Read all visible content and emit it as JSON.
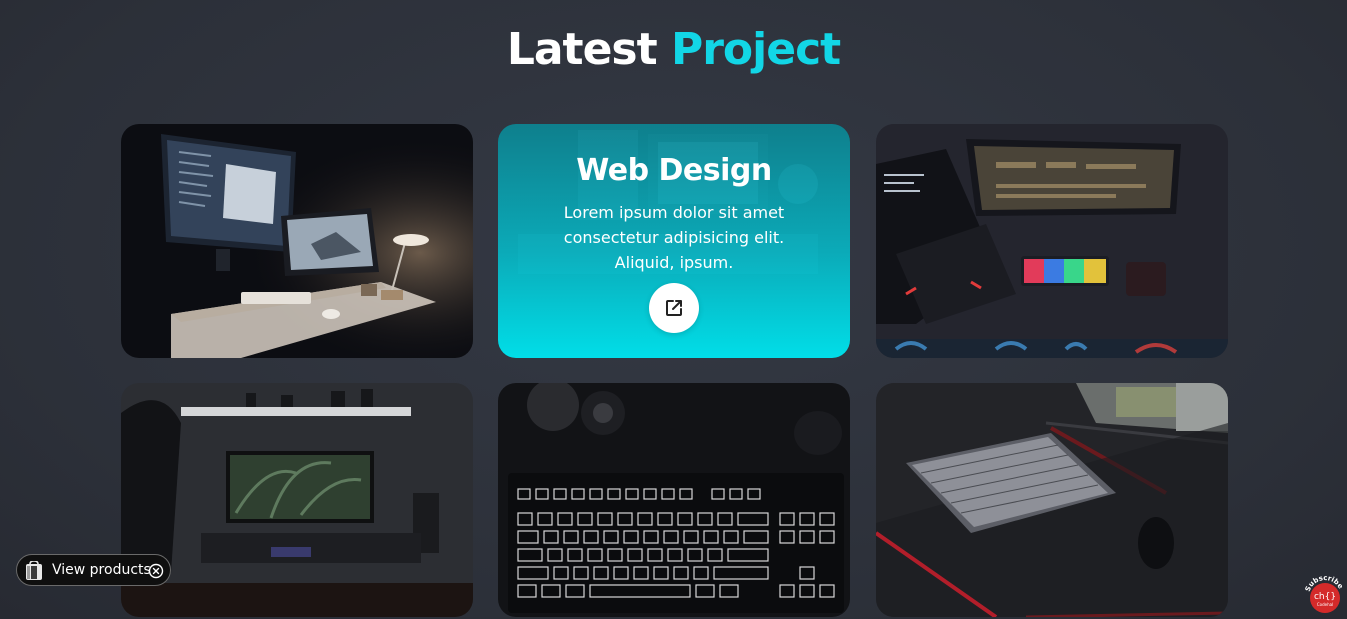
{
  "heading": {
    "word1": "Latest",
    "word2": "Project",
    "accent_color": "#12d6e6"
  },
  "cards": [
    {
      "image": "desk-setup-imac-photo"
    },
    {
      "image": "workspace-photo",
      "overlay_title": "Web Design",
      "overlay_text": "Lorem ipsum dolor sit amet consectetur adipisicing elit. Aliquid, ipsum.",
      "link_icon": "external-link-icon"
    },
    {
      "image": "laptop-rgb-keyboard-photo"
    },
    {
      "image": "monitor-shelf-photo"
    },
    {
      "image": "mechanical-keyboard-photo"
    },
    {
      "image": "keyboard-red-desk-photo"
    }
  ],
  "chip": {
    "label": "View products",
    "icon": "shopping-bag-icon",
    "close_icon": "close-circle-icon"
  },
  "subscribe_badge": {
    "text": "Subscribe",
    "logo": "ch{}",
    "sub": "Codehal",
    "color": "#d42a2a"
  }
}
